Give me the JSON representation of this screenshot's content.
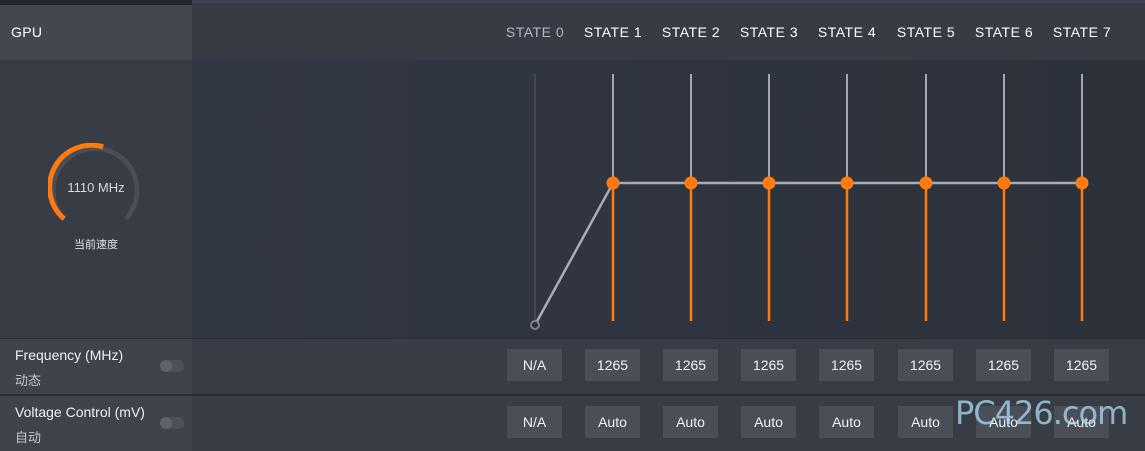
{
  "gpu": {
    "title": "GPU"
  },
  "gauge": {
    "speed_text": "1110 MHz",
    "label": "当前速度",
    "level": 0.55,
    "color": "#ff7a10"
  },
  "states": [
    {
      "label": "STATE 0",
      "dim": true
    },
    {
      "label": "STATE 1"
    },
    {
      "label": "STATE 2"
    },
    {
      "label": "STATE 3"
    },
    {
      "label": "STATE 4"
    },
    {
      "label": "STATE 5"
    },
    {
      "label": "STATE 6"
    },
    {
      "label": "STATE 7"
    }
  ],
  "frequency": {
    "title": "Frequency (MHz)",
    "mode": "动态",
    "values": [
      "N/A",
      "1265",
      "1265",
      "1265",
      "1265",
      "1265",
      "1265",
      "1265"
    ]
  },
  "voltage": {
    "title": "Voltage Control (mV)",
    "mode": "自动",
    "values": [
      "N/A",
      "Auto",
      "Auto",
      "Auto",
      "Auto",
      "Auto",
      "Auto",
      "Auto"
    ]
  },
  "colors": {
    "accent": "#ff7a10",
    "curve": "#a8adb5"
  },
  "watermark": {
    "text": "PC426.com"
  }
}
